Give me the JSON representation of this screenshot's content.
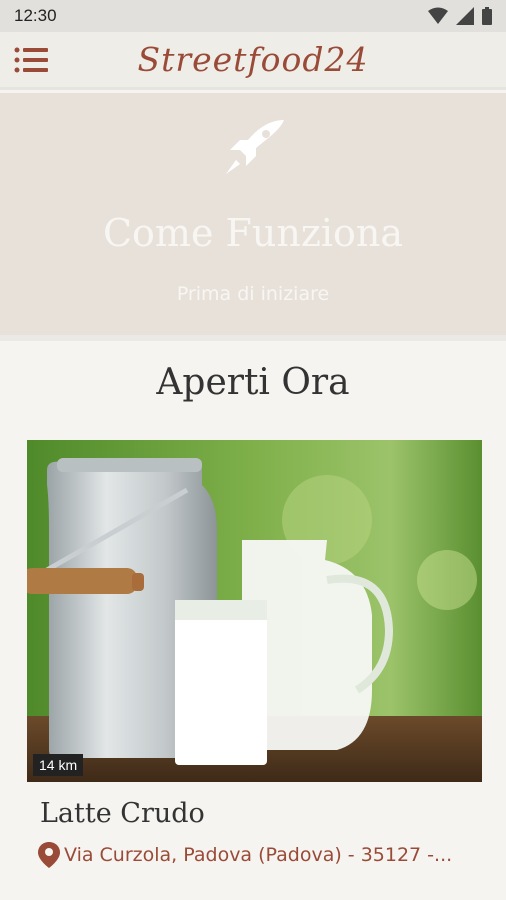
{
  "status_bar": {
    "time": "12:30",
    "icons": [
      "wifi-icon",
      "signal-icon",
      "battery-icon"
    ]
  },
  "app_bar": {
    "brand": "Streetfood24",
    "menu_icon": "hamburger-menu-icon"
  },
  "hero": {
    "icon": "rocket-icon",
    "title": "Come Funziona",
    "subtitle": "Prima di iniziare"
  },
  "section": {
    "title": "Aperti Ora"
  },
  "card": {
    "image": "milk-can-and-glass-photo",
    "distance": "14 km",
    "title": "Latte Crudo",
    "address": "Via Curzola, Padova (Padova) - 35127 -...",
    "address_icon": "location-pin-icon"
  },
  "colors": {
    "accent": "#9a4b38",
    "hero_bg": "#e8e1da",
    "app_bar_bg": "#eeede8",
    "page_bg": "#f5f4f0"
  }
}
